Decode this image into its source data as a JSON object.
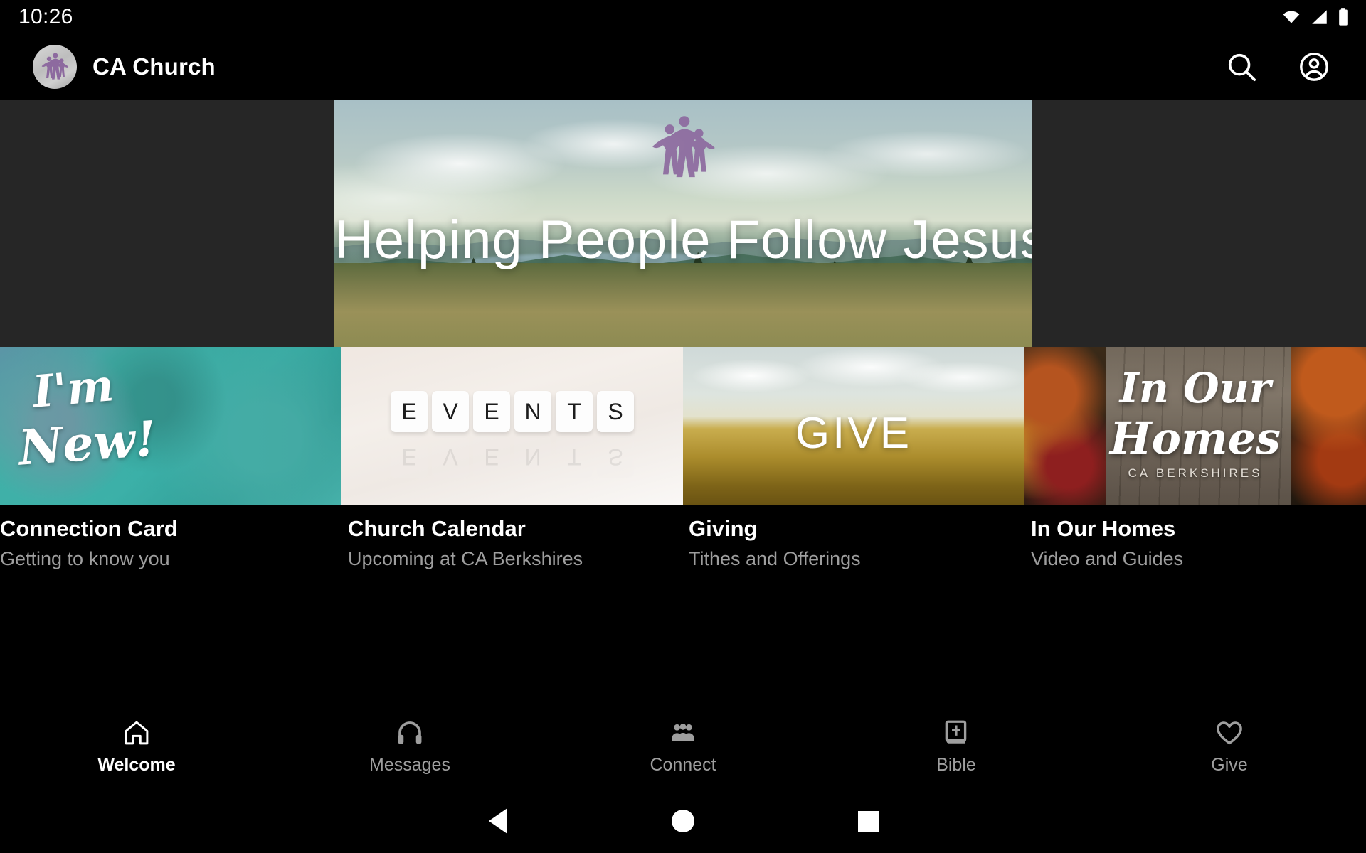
{
  "status_bar": {
    "time": "10:26",
    "icons": [
      "wifi-icon",
      "cell-signal-icon",
      "battery-icon"
    ]
  },
  "app_bar": {
    "logo_alt": "church-logo",
    "title": "CA Church",
    "actions": [
      {
        "name": "search-icon",
        "label": "Search"
      },
      {
        "name": "account-icon",
        "label": "Account"
      }
    ]
  },
  "hero": {
    "title": "Helping People Follow Jesus",
    "logo_alt": "church-logo-watermark"
  },
  "cards": [
    {
      "overlay_line1": "I'm",
      "overlay_line2": "New!",
      "title": "Connection Card",
      "subtitle": "Getting to know you"
    },
    {
      "tiles": [
        "E",
        "V",
        "E",
        "N",
        "T",
        "S"
      ],
      "title": "Church Calendar",
      "subtitle": "Upcoming at CA Berkshires"
    },
    {
      "overlay": "GIVE",
      "title": "Giving",
      "subtitle": "Tithes and Offerings"
    },
    {
      "script_line1": "In Our",
      "script_line2": "Homes",
      "script_line3": "CA BERKSHIRES",
      "title": "In Our Homes",
      "subtitle": "Video and Guides"
    }
  ],
  "bottom_nav": [
    {
      "label": "Welcome",
      "icon": "home-icon",
      "active": true
    },
    {
      "label": "Messages",
      "icon": "headphones-icon",
      "active": false
    },
    {
      "label": "Connect",
      "icon": "people-group-icon",
      "active": false
    },
    {
      "label": "Bible",
      "icon": "bible-book-icon",
      "active": false
    },
    {
      "label": "Give",
      "icon": "heart-icon",
      "active": false
    }
  ],
  "system_nav": [
    {
      "name": "back-button",
      "icon": "triangle-left-icon"
    },
    {
      "name": "home-button",
      "icon": "circle-icon"
    },
    {
      "name": "recents-button",
      "icon": "square-icon"
    }
  ],
  "colors": {
    "background": "#000000",
    "hero_letterbox": "#262626",
    "accent_purple": "#8d6a9f",
    "subtitle_gray": "#9e9e9e",
    "teal": "#3cb4ab"
  }
}
